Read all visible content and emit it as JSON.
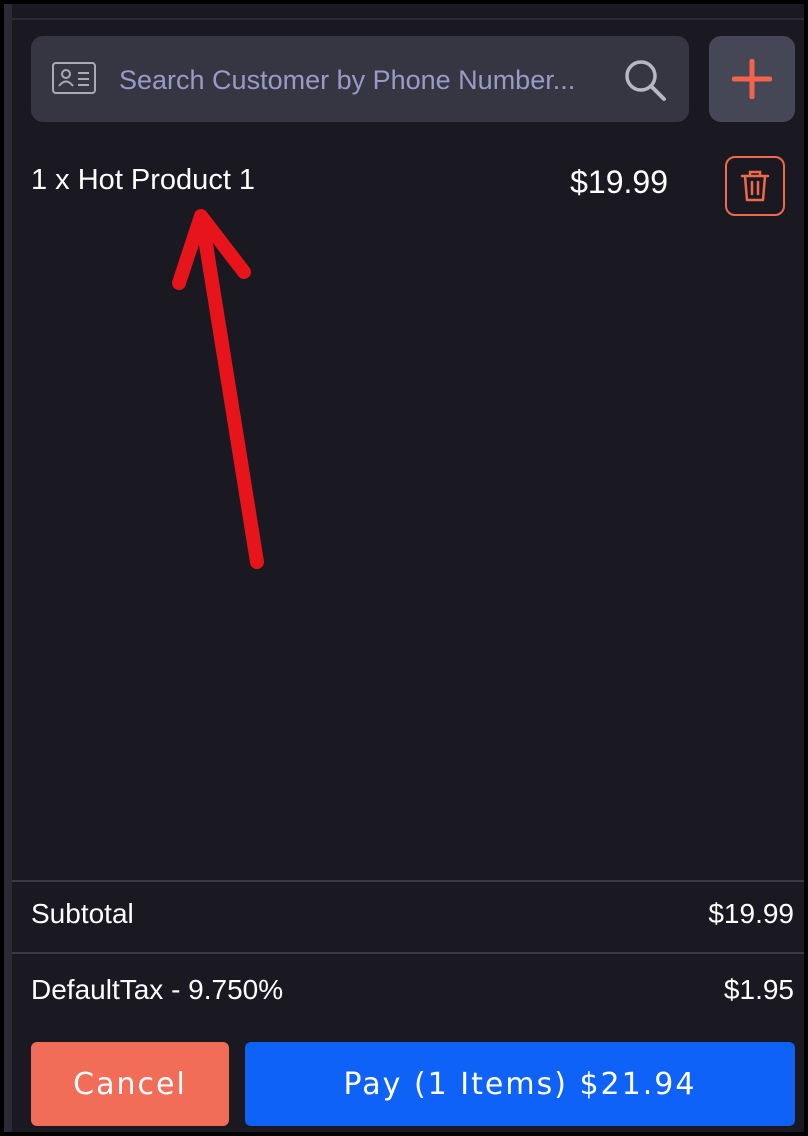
{
  "search": {
    "placeholder": "Search Customer by Phone Number..."
  },
  "cart": {
    "items": [
      {
        "label": "1 x Hot Product 1",
        "price": "$19.99"
      }
    ]
  },
  "totals": {
    "subtotal_label": "Subtotal",
    "subtotal_value": "$19.99",
    "tax_label": "DefaultTax - 9.750%",
    "tax_value": "$1.95"
  },
  "actions": {
    "cancel_label": "Cancel",
    "pay_label": "Pay (1 Items) $21.94"
  },
  "colors": {
    "background": "#1a1922",
    "accent": "#ef6a4c",
    "pay": "#0f62f8",
    "annotation_arrow": "#e8141b"
  },
  "icons": [
    "contact-card-icon",
    "search-icon",
    "plus-icon",
    "trash-icon"
  ]
}
